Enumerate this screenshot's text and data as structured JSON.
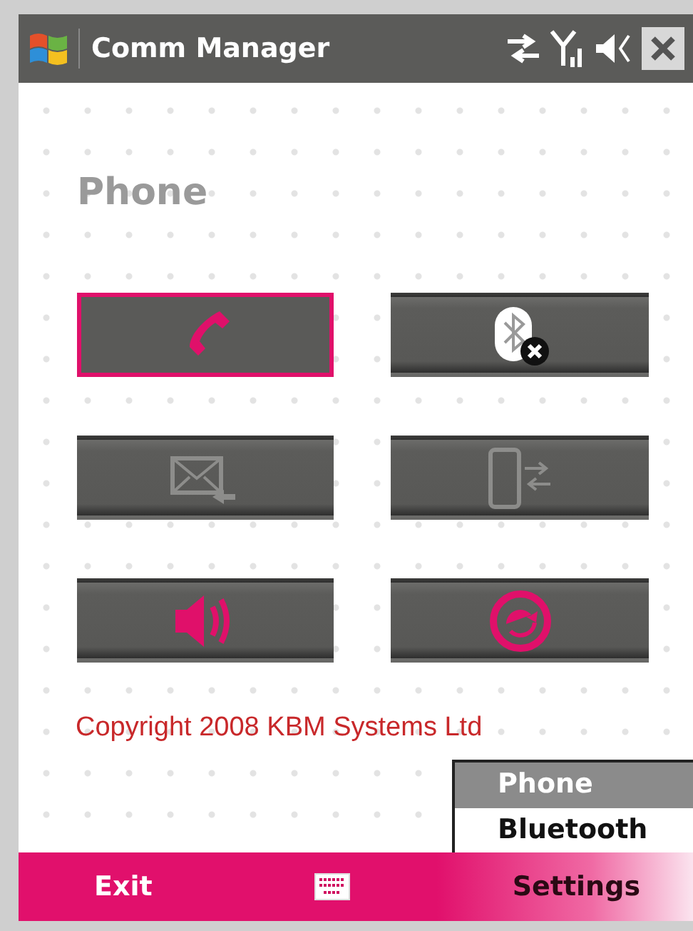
{
  "window": {
    "title": "Comm Manager"
  },
  "heading": "Phone",
  "buttons": [
    {
      "kind": "phone",
      "selected": true,
      "disabled": false
    },
    {
      "kind": "bluetooth",
      "selected": false,
      "disabled": false
    },
    {
      "kind": "mail",
      "selected": false,
      "disabled": true
    },
    {
      "kind": "transfer",
      "selected": false,
      "disabled": true
    },
    {
      "kind": "speaker",
      "selected": false,
      "disabled": false
    },
    {
      "kind": "refresh",
      "selected": false,
      "disabled": false
    }
  ],
  "copyright": "Copyright 2008 KBM Systems Ltd",
  "menu": [
    {
      "label": "Phone",
      "selected": true
    },
    {
      "label": "Bluetooth",
      "selected": false
    }
  ],
  "softkeys": {
    "left": "Exit",
    "right": "Settings"
  }
}
